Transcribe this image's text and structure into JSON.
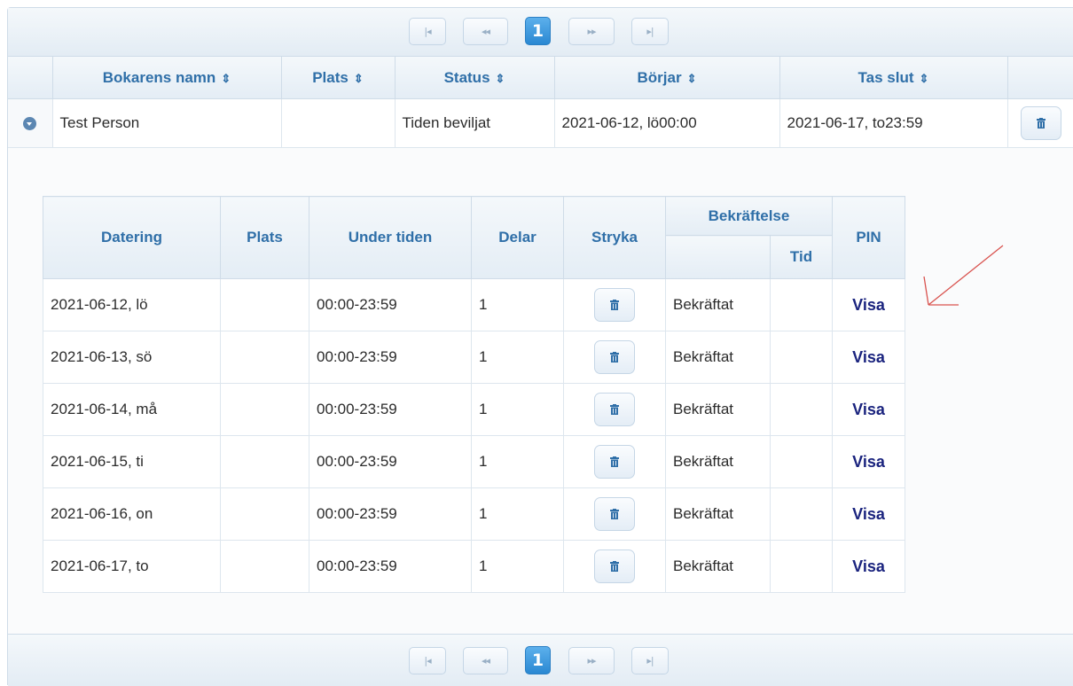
{
  "paginator": {
    "first": "|◂",
    "prev": "◂◂",
    "current_page": "1",
    "next": "▸▸",
    "last": "▸|"
  },
  "main_table": {
    "columns": [
      "Bokarens namn",
      "Plats",
      "Status",
      "Börjar",
      "Tas slut"
    ],
    "sort_icon": "⇕",
    "row": {
      "name": "Test Person",
      "place": "",
      "status": "Tiden beviljat",
      "start": "2021-06-12, lö00:00",
      "end": "2021-06-17, to23:59"
    }
  },
  "sub_table": {
    "columns": {
      "dating": "Datering",
      "place": "Plats",
      "during": "Under tiden",
      "parts": "Delar",
      "delete": "Stryka",
      "confirmation": "Bekräftelse",
      "time": "Tid",
      "pin": "PIN"
    },
    "rows": [
      {
        "date": "2021-06-12, lö",
        "place": "",
        "time_range": "00:00-23:59",
        "parts": "1",
        "confirmation": "Bekräftat",
        "time": "",
        "pin": "Visa"
      },
      {
        "date": "2021-06-13, sö",
        "place": "",
        "time_range": "00:00-23:59",
        "parts": "1",
        "confirmation": "Bekräftat",
        "time": "",
        "pin": "Visa"
      },
      {
        "date": "2021-06-14, må",
        "place": "",
        "time_range": "00:00-23:59",
        "parts": "1",
        "confirmation": "Bekräftat",
        "time": "",
        "pin": "Visa"
      },
      {
        "date": "2021-06-15, ti",
        "place": "",
        "time_range": "00:00-23:59",
        "parts": "1",
        "confirmation": "Bekräftat",
        "time": "",
        "pin": "Visa"
      },
      {
        "date": "2021-06-16, on",
        "place": "",
        "time_range": "00:00-23:59",
        "parts": "1",
        "confirmation": "Bekräftat",
        "time": "",
        "pin": "Visa"
      },
      {
        "date": "2021-06-17, to",
        "place": "",
        "time_range": "00:00-23:59",
        "parts": "1",
        "confirmation": "Bekräftat",
        "time": "",
        "pin": "Visa"
      }
    ]
  },
  "colors": {
    "header_text": "#2f6fa8",
    "link": "#1a237e",
    "annotation_arrow": "#d9534f",
    "current_page_bg": "#2a88d2"
  }
}
